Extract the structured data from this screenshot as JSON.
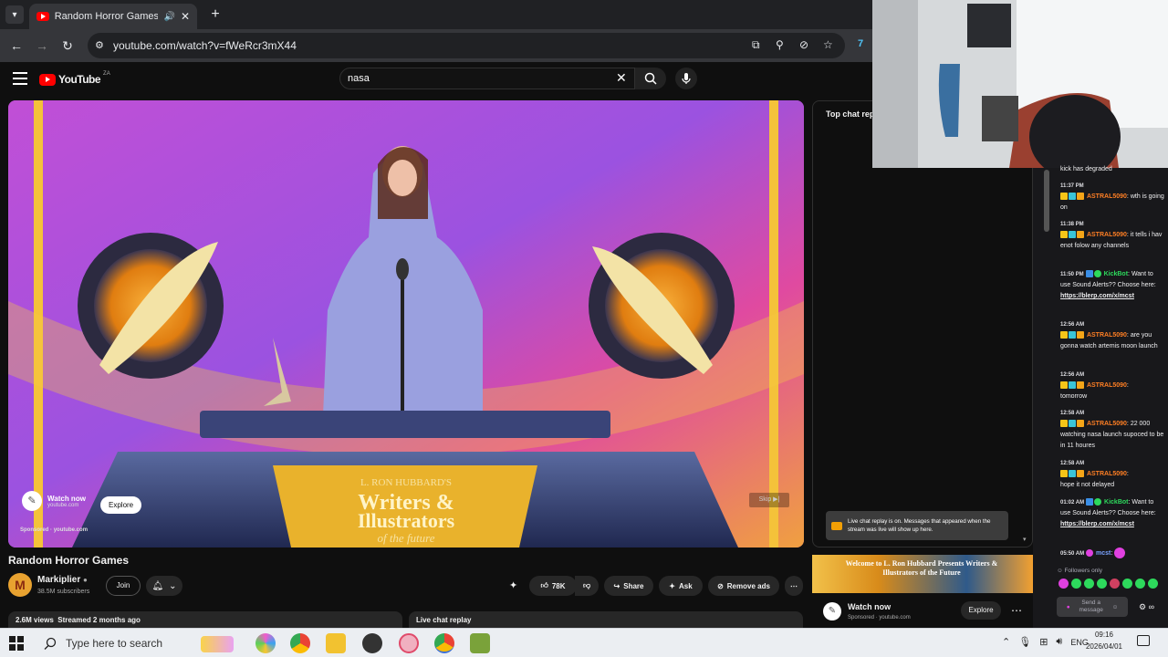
{
  "browser": {
    "tab_title": "Random Horror Games - Yo",
    "url": "youtube.com/watch?v=fWeRcr3mX44"
  },
  "youtube": {
    "logo_text": "YouTube",
    "region": "ZA",
    "search_value": "nasa"
  },
  "video": {
    "ad_overlay_text": "L. RON HUBBARD'S Writers & Illustrators of the future",
    "ad_watch_now": "Watch now",
    "ad_domain": "youtube.com",
    "ad_explore": "Explore",
    "ad_sponsored": "Sponsored",
    "ad_sponsored_domain": "youtube.com",
    "skip": "Skip"
  },
  "meta": {
    "title": "Random Horror Games",
    "channel": "Markiplier",
    "subscribers": "38.5M subscribers",
    "join": "Join",
    "likes": "78K",
    "share": "Share",
    "ask": "Ask",
    "remove_ads": "Remove ads",
    "views": "2.6M views  Streamed 2 months ago",
    "live_chat_replay": "Live chat replay"
  },
  "chat_panel": {
    "header": "Top chat rep",
    "replay_note": "Live chat replay is on. Messages that appeared when the stream was live will show up here.",
    "ad_banner": "Welcome to L. Ron Hubbard Presents Writers & Illustrators of the Future",
    "ad_watch_now": "Watch now",
    "ad_sub": "Sponsored · youtube.com",
    "ad_explore": "Explore"
  },
  "twitch_chat": {
    "messages": [
      {
        "time": "",
        "user": "",
        "text": "kick has degraded"
      },
      {
        "time": "11:37 PM",
        "user": "ASTRAL5090",
        "text": "wth is going on"
      },
      {
        "time": "11:38 PM",
        "user": "ASTRAL5090",
        "text": "it tells i hav enot folow any channels"
      },
      {
        "time": "11:50 PM",
        "user": "KickBot",
        "text": "Want to use Sound Alerts?? Choose here:",
        "link": "https://blerp.com/x/mcst"
      },
      {
        "time": "12:56 AM",
        "user": "ASTRAL5090",
        "text": "are you gonna watch artemis moon launch"
      },
      {
        "time": "12:56 AM",
        "user": "ASTRAL5090",
        "text": "tomorrow"
      },
      {
        "time": "12:58 AM",
        "user": "ASTRAL5090",
        "text": "22 000 watching nasa launch supoced to be in 11 houres"
      },
      {
        "time": "12:58 AM",
        "user": "ASTRAL5090",
        "text": "hope it not delayed"
      },
      {
        "time": "01:02 AM",
        "user": "KickBot",
        "text": "Want to use Sound Alerts?? Choose here:",
        "link": "https://blerp.com/x/mcst"
      },
      {
        "time": "05:50 AM",
        "user": "mcst",
        "text": ""
      }
    ],
    "followers_only": "Followers only",
    "send_placeholder": "Send a message",
    "points": "∞"
  },
  "taskbar": {
    "search_placeholder": "Type here to search",
    "lang": "ENG",
    "time": "09:16",
    "date": "2026/04/01"
  }
}
